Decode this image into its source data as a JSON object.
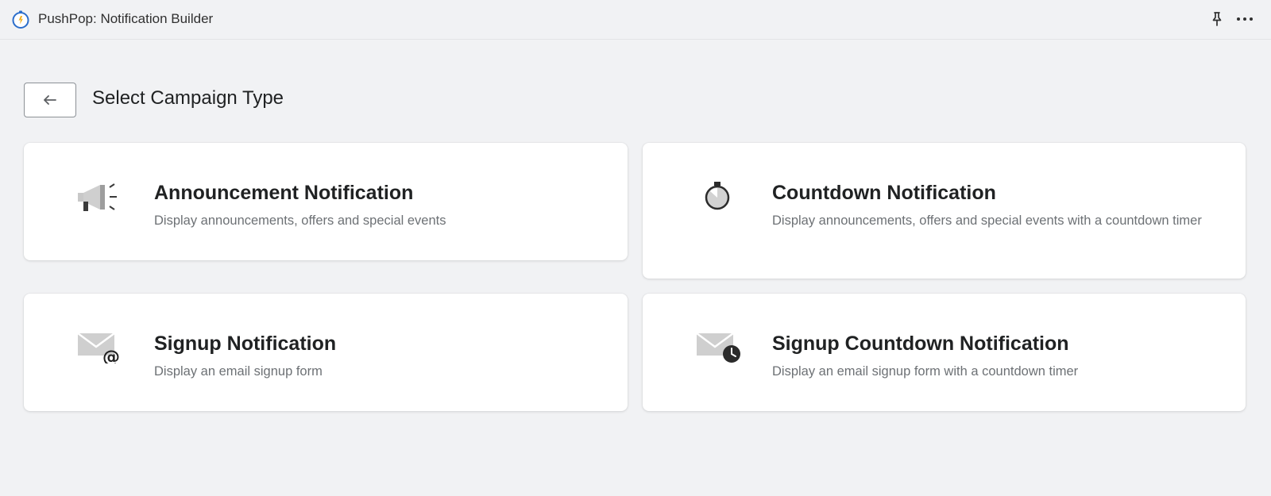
{
  "app": {
    "title": "PushPop: Notification Builder",
    "logo_icon": "stopwatch-logo-icon",
    "accent": "#2c6ecb"
  },
  "toolbar": {
    "pin_icon": "pin-icon",
    "more_icon": "more-horizontal-icon"
  },
  "page": {
    "back_icon": "arrow-left-icon",
    "title": "Select Campaign Type"
  },
  "cards": [
    {
      "icon": "megaphone-icon",
      "title": "Announcement Notification",
      "description": "Display announcements, offers and special events"
    },
    {
      "icon": "stopwatch-icon",
      "title": "Countdown Notification",
      "description": "Display announcements, offers and special events with a countdown timer"
    },
    {
      "icon": "envelope-at-icon",
      "title": "Signup Notification",
      "description": "Display an email signup form"
    },
    {
      "icon": "envelope-clock-icon",
      "title": "Signup Countdown Notification",
      "description": "Display an email signup form with a countdown timer"
    }
  ]
}
